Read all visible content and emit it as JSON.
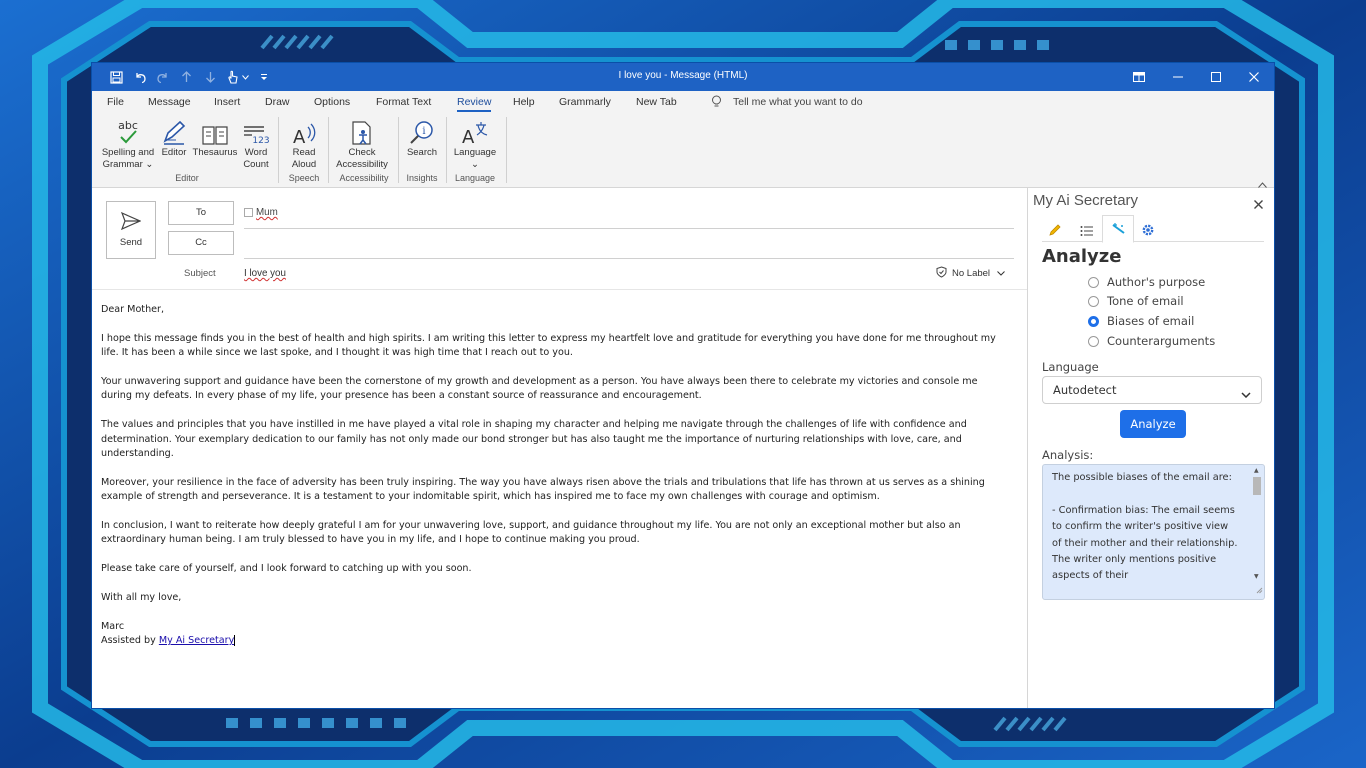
{
  "window": {
    "title": "I love you  -  Message (HTML)"
  },
  "menu": {
    "tabs": [
      {
        "label": "File"
      },
      {
        "label": "Message"
      },
      {
        "label": "Insert"
      },
      {
        "label": "Draw"
      },
      {
        "label": "Options"
      },
      {
        "label": "Format Text"
      },
      {
        "label": "Review"
      },
      {
        "label": "Help"
      },
      {
        "label": "Grammarly"
      },
      {
        "label": "New Tab"
      }
    ],
    "active_tab": "Review",
    "tell_me": "Tell me what you want to do"
  },
  "ribbon": {
    "spelling": {
      "line1": "Spelling and",
      "line2": "Grammar",
      "icon_text": "abc"
    },
    "editor": {
      "label": "Editor"
    },
    "thesaurus": {
      "label": "Thesaurus"
    },
    "word_count": {
      "line1": "Word",
      "line2": "Count",
      "icon_text": "123"
    },
    "read_aloud": {
      "line1": "Read",
      "line2": "Aloud"
    },
    "check_accessibility": {
      "line1": "Check",
      "line2": "Accessibility"
    },
    "search": {
      "label": "Search"
    },
    "language": {
      "label": "Language"
    },
    "groups": {
      "editor": "Editor",
      "speech": "Speech",
      "accessibility": "Accessibility",
      "insights": "Insights",
      "language": "Language"
    }
  },
  "compose": {
    "send_label": "Send",
    "to_label": "To",
    "cc_label": "Cc",
    "to_value": "Mum",
    "subject_label": "Subject",
    "subject_value": "I love you",
    "sensitivity": "No Label"
  },
  "body": {
    "greeting": "Dear Mother,",
    "paragraphs": [
      "I hope this message finds you in the best of health and high spirits. I am writing this letter to express my heartfelt love and gratitude for everything you have done for me throughout my life. It has been a while since we last spoke, and I thought it was high time that I reach out to you.",
      "Your unwavering support and guidance have been the cornerstone of my growth and development as a person. You have always been there to celebrate my victories and console me during my defeats. In every phase of my life, your presence has been a constant source of reassurance and encouragement.",
      "The values and principles that you have instilled in me have played a vital role in shaping my character and helping me navigate through the challenges of life with confidence and determination. Your exemplary dedication to our family has not only made our bond stronger but has also taught me the importance of nurturing relationships with love, care, and understanding.",
      "Moreover, your resilience in the face of adversity has been truly inspiring. The way you have always risen above the trials and tribulations that life has thrown at us serves as a shining example of strength and perseverance. It is a testament to your indomitable spirit, which has inspired me to face my own challenges with courage and optimism.",
      "In conclusion, I want to reiterate how deeply grateful I am for your unwavering love, support, and guidance throughout my life. You are not only an exceptional mother but also an extraordinary human being. I am truly blessed to have you in my life, and I hope to continue making you proud.",
      "Please take care of yourself, and I look forward to catching up with you soon."
    ],
    "closing": "With all my love,",
    "signature": "Marc",
    "assisted_prefix": "Assisted by ",
    "assisted_link": "My Ai Secretary"
  },
  "pane": {
    "title": "My Ai Secretary",
    "heading": "Analyze",
    "options": [
      {
        "label": "Author's purpose",
        "checked": false
      },
      {
        "label": "Tone of email",
        "checked": false
      },
      {
        "label": "Biases of email",
        "checked": true
      },
      {
        "label": "Counterarguments",
        "checked": false
      }
    ],
    "language_label": "Language",
    "language_value": "Autodetect",
    "analyze_button": "Analyze",
    "analysis_label": "Analysis:",
    "analysis_text": "The possible biases of the email are:\n\n- Confirmation bias: The email seems to confirm the writer's positive view of their mother and their relationship. The writer only mentions positive aspects of their"
  },
  "colors": {
    "title_bar": "#1e62c4",
    "accent": "#1e6fe8",
    "analysis_bg": "#dde9fb",
    "link": "#1a0dab"
  }
}
